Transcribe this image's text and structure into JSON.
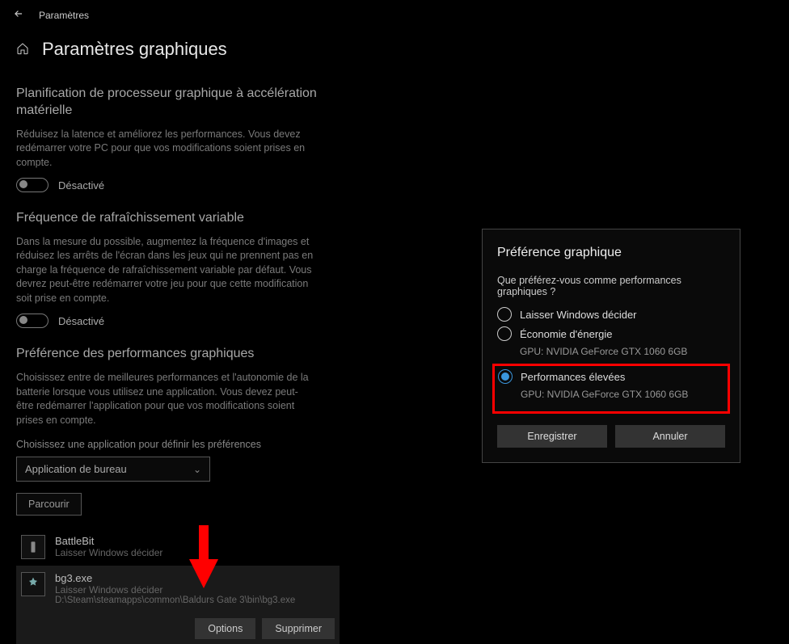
{
  "header": {
    "breadcrumb": "Paramètres",
    "title": "Paramètres graphiques"
  },
  "sections": {
    "hw_sched": {
      "title": "Planification de processeur graphique à accélération matérielle",
      "desc": "Réduisez la latence et améliorez les performances. Vous devez redémarrer votre PC pour que vos modifications soient prises en compte.",
      "state": "Désactivé"
    },
    "vrr": {
      "title": "Fréquence de rafraîchissement variable",
      "desc": "Dans la mesure du possible, augmentez la fréquence d'images et réduisez les arrêts de l'écran dans les jeux qui ne prennent pas en charge la fréquence de rafraîchissement variable par défaut. Vous devrez peut-être redémarrer votre jeu pour que cette modification soit prise en compte.",
      "state": "Désactivé"
    },
    "perf": {
      "title": "Préférence des performances graphiques",
      "desc": "Choisissez entre de meilleures performances et l'autonomie de la batterie lorsque vous utilisez une application. Vous devez peut-être redémarrer l'application pour que vos modifications soient prises en compte.",
      "choose_label": "Choisissez une application pour définir les préférences",
      "dropdown_value": "Application de bureau",
      "browse": "Parcourir"
    }
  },
  "apps": [
    {
      "name": "BattleBit",
      "pref": "Laisser Windows décider",
      "path": "",
      "selected": false
    },
    {
      "name": "bg3.exe",
      "pref": "Laisser Windows décider",
      "path": "D:\\Steam\\steamapps\\common\\Baldurs Gate 3\\bin\\bg3.exe",
      "selected": true
    }
  ],
  "app_buttons": {
    "options": "Options",
    "remove": "Supprimer"
  },
  "popup": {
    "title": "Préférence graphique",
    "question": "Que préférez-vous comme performances graphiques ?",
    "opts": [
      {
        "label": "Laisser Windows décider",
        "sub": "",
        "checked": false
      },
      {
        "label": "Économie d'énergie",
        "sub": "GPU: NVIDIA GeForce GTX 1060 6GB",
        "checked": false
      },
      {
        "label": "Performances élevées",
        "sub": "GPU: NVIDIA GeForce GTX 1060 6GB",
        "checked": true
      }
    ],
    "save": "Enregistrer",
    "cancel": "Annuler"
  }
}
